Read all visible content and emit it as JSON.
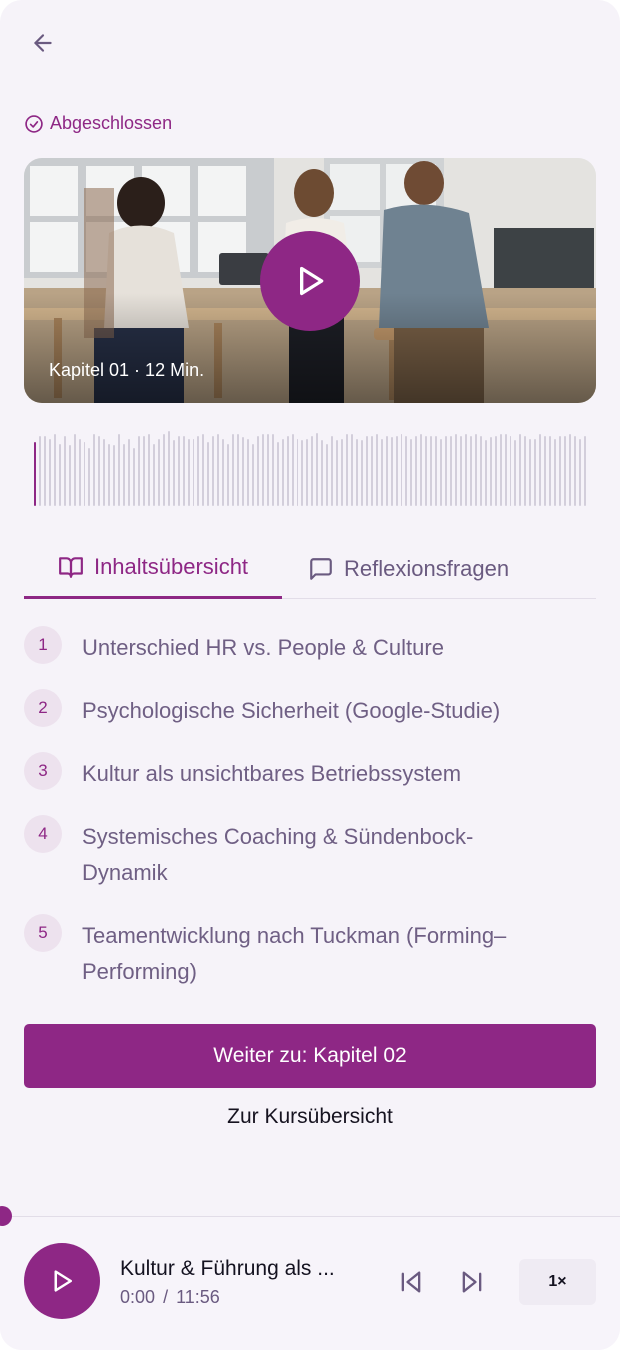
{
  "header": {
    "back_icon": "arrow-left-icon",
    "status_icon": "check-circle-icon",
    "status_label": "Abgeschlossen"
  },
  "hero": {
    "caption": "Kapitel 01 · 12 Min.",
    "play_icon": "play-icon"
  },
  "waveform": {
    "progress_fraction": 0.01,
    "amplitudes": [
      0.82,
      0.9,
      0.9,
      0.86,
      0.92,
      0.8,
      0.9,
      0.78,
      0.92,
      0.86,
      0.82,
      0.74,
      0.92,
      0.9,
      0.86,
      0.8,
      0.78,
      0.92,
      0.8,
      0.86,
      0.74,
      0.9,
      0.9,
      0.92,
      0.8,
      0.86,
      0.92,
      0.96,
      0.84,
      0.9,
      0.9,
      0.86,
      0.86,
      0.9,
      0.92,
      0.82,
      0.9,
      0.92,
      0.86,
      0.8,
      0.92,
      0.92,
      0.88,
      0.86,
      0.8,
      0.9,
      0.92,
      0.92,
      0.92,
      0.82,
      0.86,
      0.9,
      0.92,
      0.86,
      0.84,
      0.86,
      0.9,
      0.94,
      0.84,
      0.8,
      0.9,
      0.84,
      0.86,
      0.92,
      0.92,
      0.86,
      0.84,
      0.9,
      0.9,
      0.92,
      0.86,
      0.9,
      0.88,
      0.9,
      0.92,
      0.9,
      0.86,
      0.9,
      0.92,
      0.9,
      0.9,
      0.9,
      0.86,
      0.9,
      0.9,
      0.92,
      0.9,
      0.92,
      0.9,
      0.92,
      0.9,
      0.84,
      0.88,
      0.9,
      0.92,
      0.92,
      0.9,
      0.84,
      0.92,
      0.9,
      0.86,
      0.86,
      0.92,
      0.9,
      0.9,
      0.86,
      0.9,
      0.9,
      0.92,
      0.9,
      0.86,
      0.9,
      0.92,
      0.9,
      0.9,
      0.9,
      0.86,
      0.88,
      0.9,
      0.9,
      0.9,
      0.86,
      0.84,
      0.92,
      0.9,
      0.9
    ]
  },
  "tabs": [
    {
      "label": "Inhaltsübersicht",
      "icon": "book-open-icon",
      "active": true
    },
    {
      "label": "Reflexionsfragen",
      "icon": "message-square-icon",
      "active": false
    }
  ],
  "toc": [
    {
      "number": "1",
      "title": "Unterschied HR vs. People & Culture"
    },
    {
      "number": "2",
      "title": "Psychologische Sicherheit (Google-Studie)"
    },
    {
      "number": "3",
      "title": "Kultur als unsichtbares Betriebssystem"
    },
    {
      "number": "4",
      "title": "Systemisches Coaching & Sündenbock-Dynamik"
    },
    {
      "number": "5",
      "title": "Teamentwicklung nach Tuckman (Forming–Performing)"
    }
  ],
  "actions": {
    "next_label": "Weiter zu: Kapitel 02",
    "overview_label": "Zur Kursübersicht"
  },
  "player": {
    "title": "Kultur & Führung als ...",
    "current_time": "0:00",
    "separator": "/",
    "duration": "11:56",
    "progress_fraction": 0.0,
    "speed": "1×",
    "icons": {
      "play": "play-icon",
      "previous": "skip-back-icon",
      "next": "skip-forward-icon"
    }
  },
  "colors": {
    "accent": "#8e2785",
    "background": "#f6f3f9",
    "muted_text": "#6f5f84",
    "wave_inactive": "#d3cedb"
  }
}
